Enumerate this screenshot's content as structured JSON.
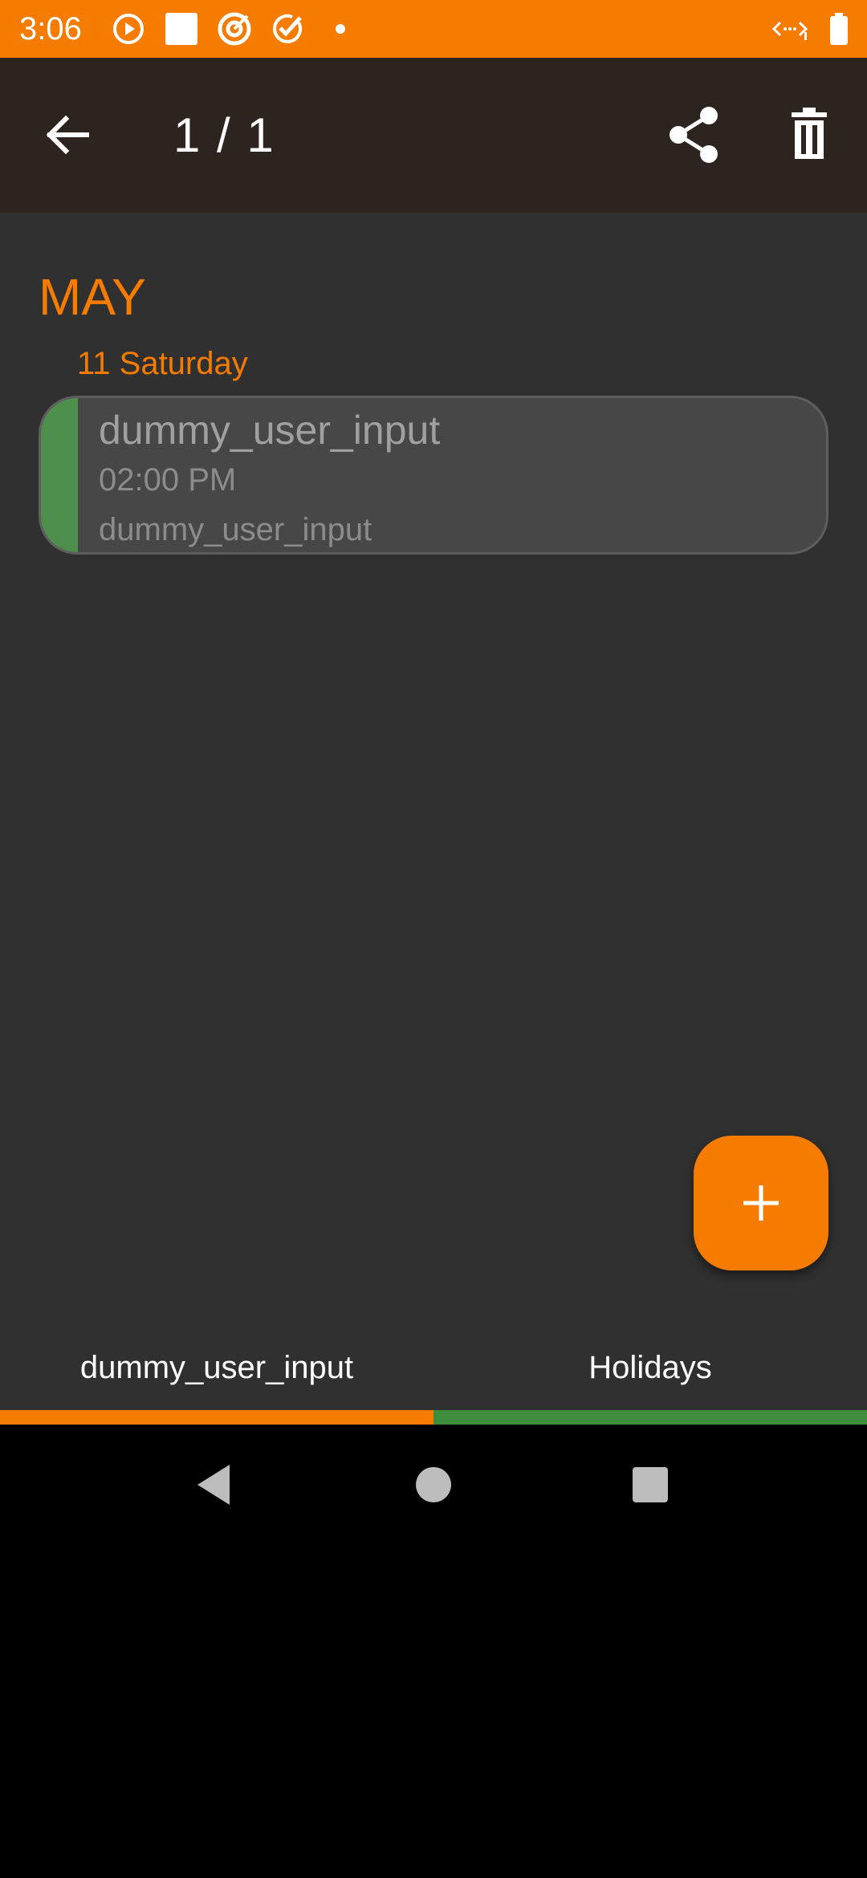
{
  "status_bar": {
    "time": "3:06",
    "icons": [
      "play-circle-icon",
      "square-notification-icon",
      "target-icon",
      "check-circle-icon",
      "dot-icon",
      "network-icon",
      "battery-icon"
    ]
  },
  "toolbar": {
    "back_icon": "arrow-left-icon",
    "title": "1 / 1",
    "share_icon": "share-icon",
    "delete_icon": "trash-icon"
  },
  "content": {
    "month": "MAY",
    "day": "11 Saturday",
    "event": {
      "title": "dummy_user_input",
      "time": "02:00 PM",
      "description": "dummy_user_input",
      "color": "#4E8F4E"
    }
  },
  "fab": {
    "icon": "plus-icon",
    "color": "#F57C00"
  },
  "tabs": [
    {
      "label": "dummy_user_input",
      "color": "#F57C00"
    },
    {
      "label": "Holidays",
      "color": "#3E8E3E"
    }
  ],
  "nav_bar": {
    "icons": [
      "back-triangle-icon",
      "home-circle-icon",
      "recents-square-icon"
    ]
  },
  "colors": {
    "accent": "#F57C00",
    "toolbar": "#2D2420",
    "background": "#303030",
    "card": "#474747"
  }
}
